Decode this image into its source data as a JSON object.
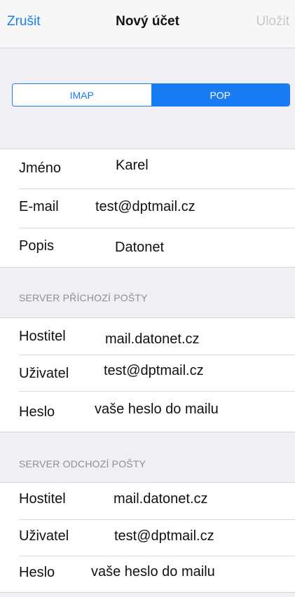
{
  "nav": {
    "cancel": "Zrušit",
    "title": "Nový účet",
    "save": "Uložit"
  },
  "segmented": {
    "imap": "IMAP",
    "pop": "POP",
    "selected": "POP"
  },
  "colors": {
    "accent": "#1a7cf5",
    "disabled": "#c8c8cc",
    "background": "#efeff4"
  },
  "account": {
    "name_label": "Jméno",
    "name_value": "Karel",
    "email_label": "E-mail",
    "email_value": "test@dptmail.cz",
    "description_label": "Popis",
    "description_value": "Datonet"
  },
  "incoming": {
    "header": "SERVER PŘÍCHOZÍ POŠTY",
    "host_label": "Hostitel",
    "host_value": "mail.datonet.cz",
    "user_label": "Uživatel",
    "user_value": "test@dptmail.cz",
    "password_label": "Heslo",
    "password_value": "vaše heslo do mailu"
  },
  "outgoing": {
    "header": "SERVER ODCHOZÍ POŠTY",
    "host_label": "Hostitel",
    "host_value": "mail.datonet.cz",
    "user_label": "Uživatel",
    "user_value": "test@dptmail.cz",
    "password_label": "Heslo",
    "password_value": "vaše heslo do mailu"
  }
}
